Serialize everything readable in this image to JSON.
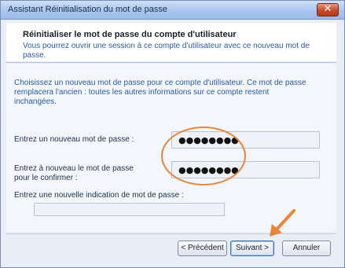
{
  "window": {
    "title": "Assistant Réinitialisation du mot de passe",
    "close_glyph": "✕"
  },
  "header": {
    "title": "Réinitialiser le mot de passe du compte d'utilisateur",
    "description": "Vous pourrez ouvrir une session à ce compte d'utilisateur avec ce nouveau mot de passe."
  },
  "content": {
    "intro": "Choisissez un nouveau mot de passe pour ce compte d'utilisateur. Ce mot de passe remplacera l'ancien : toutes les autres informations sur ce compte restent inchangées.",
    "new_password": {
      "label": "Entrez un nouveau mot de passe :",
      "value": "●●●●●●●●"
    },
    "confirm_password": {
      "label_line1": "Entrez à nouveau le mot de passe",
      "label_line2": "pour le confirmer :",
      "value": "●●●●●●●●"
    },
    "hint": {
      "label": "Entrez une nouvelle indication de mot de passe :",
      "value": ""
    }
  },
  "buttons": {
    "back": "< Précédent",
    "next": "Suivant >",
    "cancel": "Annuler"
  },
  "annotations": {
    "color": "#e7863b",
    "oval_icon": "highlight-oval",
    "arrow_icon": "pointer-arrow"
  }
}
